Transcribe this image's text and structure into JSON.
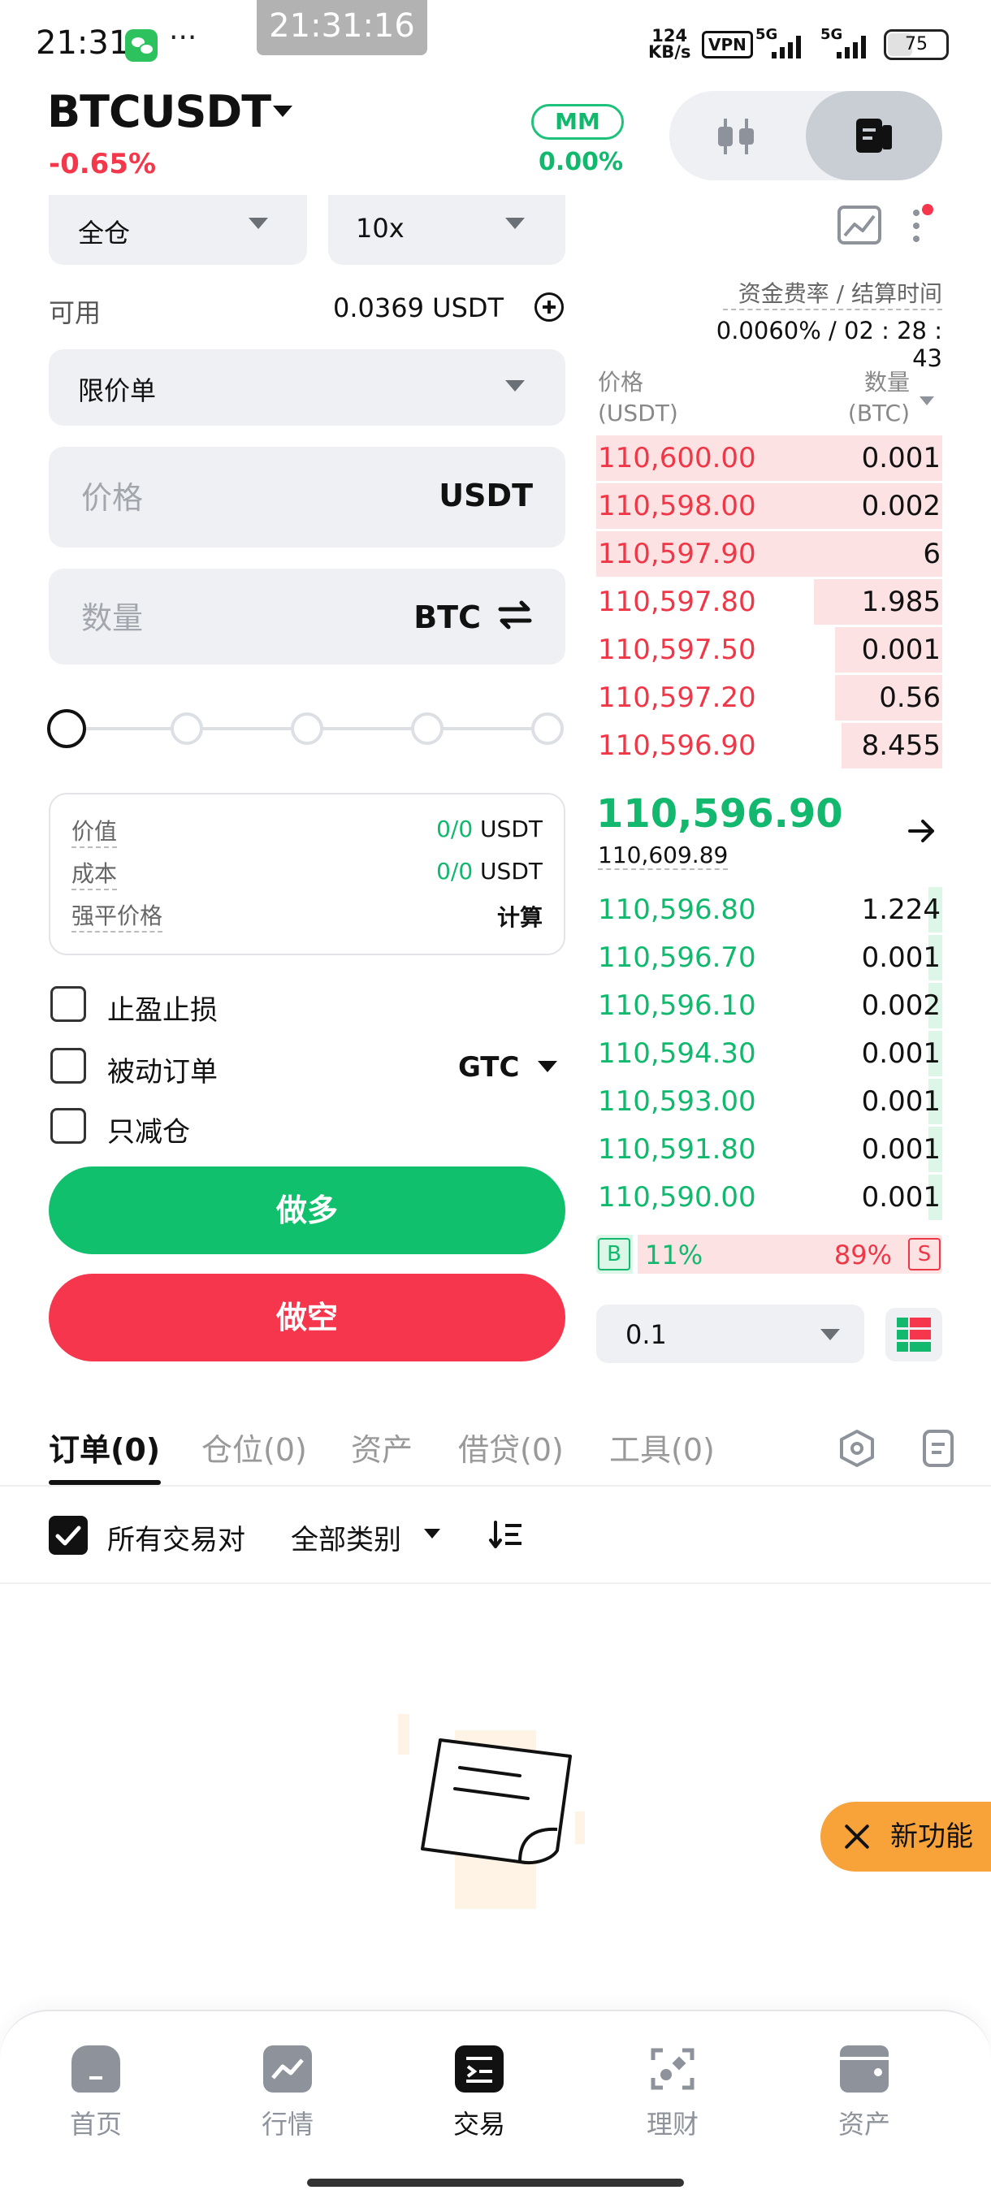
{
  "status_bar": {
    "time": "21:31",
    "clock_pill": "21:31:16",
    "more": "···",
    "net_speed_value": "124",
    "net_speed_unit": "KB/s",
    "vpn": "VPN",
    "signal_1": "5G",
    "signal_2": "5G",
    "battery": "75"
  },
  "header": {
    "pair": "BTCUSDT",
    "change": "-0.65%",
    "mm_label": "MM",
    "mm_value": "0.00%"
  },
  "order_form": {
    "margin_mode": "全仓",
    "leverage": "10x",
    "available_label": "可用",
    "available_value": "0.0369 USDT",
    "order_type": "限价单",
    "price_placeholder": "价格",
    "price_unit": "USDT",
    "qty_placeholder": "数量",
    "qty_unit": "BTC",
    "slider_level": 0,
    "summary": {
      "value_label": "价值",
      "value_green": "0/0",
      "value_unit": " USDT",
      "cost_label": "成本",
      "cost_green": "0/0",
      "cost_unit": " USDT",
      "liq_label": "强平价格",
      "liq_action": "计算"
    },
    "options": {
      "tp_sl": "止盈止损",
      "post_only": "被动订单",
      "tif": "GTC",
      "reduce_only": "只减仓"
    },
    "long_button": "做多",
    "short_button": "做空"
  },
  "funding": {
    "label": "资金费率 / 结算时间",
    "value": "0.0060% / 02 : 28 : 43"
  },
  "orderbook": {
    "price_header": "价格",
    "price_unit": "(USDT)",
    "qty_header": "数量",
    "qty_unit": "(BTC)",
    "asks": [
      {
        "price": "110,600.00",
        "qty": "0.001",
        "depth": 1.0
      },
      {
        "price": "110,598.00",
        "qty": "0.002",
        "depth": 1.0
      },
      {
        "price": "110,597.90",
        "qty": "6",
        "depth": 1.0
      },
      {
        "price": "110,597.80",
        "qty": "1.985",
        "depth": 0.37
      },
      {
        "price": "110,597.50",
        "qty": "0.001",
        "depth": 0.31
      },
      {
        "price": "110,597.20",
        "qty": "0.56",
        "depth": 0.31
      },
      {
        "price": "110,596.90",
        "qty": "8.455",
        "depth": 0.29
      }
    ],
    "last_price": "110,596.90",
    "mark_price": "110,609.89",
    "bids": [
      {
        "price": "110,596.80",
        "qty": "1.224",
        "depth": 0.04
      },
      {
        "price": "110,596.70",
        "qty": "0.001",
        "depth": 0.04
      },
      {
        "price": "110,596.10",
        "qty": "0.002",
        "depth": 0.04
      },
      {
        "price": "110,594.30",
        "qty": "0.001",
        "depth": 0.04
      },
      {
        "price": "110,593.00",
        "qty": "0.001",
        "depth": 0.04
      },
      {
        "price": "110,591.80",
        "qty": "0.001",
        "depth": 0.04
      },
      {
        "price": "110,590.00",
        "qty": "0.001",
        "depth": 0.04
      }
    ],
    "buy_label": "B",
    "buy_pct": "11%",
    "sell_pct": "89%",
    "sell_label": "S",
    "buy_ratio": 0.11,
    "depth_step": "0.1"
  },
  "tabs": [
    {
      "label": "订单(0)"
    },
    {
      "label": "仓位(0)"
    },
    {
      "label": "资产"
    },
    {
      "label": "借贷(0)"
    },
    {
      "label": "工具(0)"
    }
  ],
  "filter": {
    "all_pairs": "所有交易对",
    "all_types": "全部类别"
  },
  "fab": {
    "label": "新功能"
  },
  "bottom_nav": [
    {
      "label": "首页"
    },
    {
      "label": "行情"
    },
    {
      "label": "交易"
    },
    {
      "label": "理财"
    },
    {
      "label": "资产"
    }
  ],
  "colors": {
    "green": "#11b86e",
    "red": "#f2384a",
    "accent_orange": "#f7a33a"
  }
}
